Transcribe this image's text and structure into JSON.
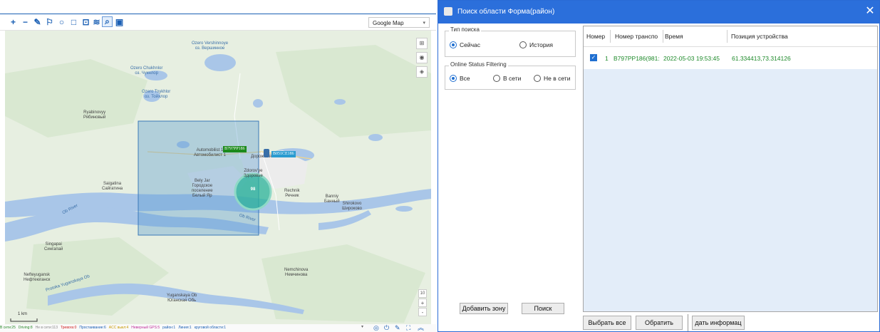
{
  "map": {
    "map_type": "Google Map",
    "labels": {
      "ozero_vershinnoye": "Ozero Vershinnoye\nоз. Вершинное",
      "ozero_chukhnlor": "Ozero Chukhnlor\nоз. Чукнлор",
      "ozero_toykhlor": "Ozero Toykhlor\nоз. Тойхлор",
      "ryabinovyy": "Ryabinovyy\nРябиновый",
      "automobilist": "Automobilist 1\nАвтомобилист 1",
      "zdorovye": "Zdorov'ye\nЗдоровье",
      "beliy_yar": "Bely Jar\nГородское\nпоселение\nБелый Яр",
      "saigatina": "Saigatina\nСайгатина",
      "ob_river_1": "Ob River",
      "ob_river_2": "Ob River",
      "rechnik": "Rechnik\nРечник",
      "banniy": "Banniy\nБанный",
      "shirokovo": "Shirokovo\nШироково",
      "singapai": "Singapai\nСингапай",
      "nefteyugansk": "Nefteyugansk\nНефтеюганск",
      "protoka": "Protoka Yuganskaya Ob",
      "nemchinova": "Nemchinova\nНемчинова",
      "yuganskaya_ob": "Yuganskaya Ob\nЮганская Обь",
      "dorozhniy": "Дорожный"
    },
    "vehicle_marker_1": "B797PP186",
    "vehicle_marker_2": "B051CE186",
    "cluster_count": "98",
    "scale": "1 km",
    "zoom_level": "10",
    "zoom_plus": "+",
    "zoom_minus": "-"
  },
  "statusbar": {
    "items": [
      {
        "text": "В сети:25",
        "color": "#2a8a2a"
      },
      {
        "text": "Driving:8",
        "color": "#2a8a2a"
      },
      {
        "text": "Не в сети:113",
        "color": "#888888"
      },
      {
        "text": "Тревога:0",
        "color": "#d02020"
      },
      {
        "text": "Простаивание:6",
        "color": "#1a5fb4"
      },
      {
        "text": "ACC выкл:4",
        "color": "#c69a00"
      },
      {
        "text": "Неверный GPS:5",
        "color": "#c0309a"
      },
      {
        "text": "район:1",
        "color": "#1a5fb4"
      },
      {
        "text": "Линия:1",
        "color": "#1a5fb4"
      },
      {
        "text": "круговой области:1",
        "color": "#1a5fb4"
      }
    ]
  },
  "dialog": {
    "title": "Поиск области Форма(район)",
    "close": "✕",
    "search_type": {
      "legend": "Тип поиска",
      "now": "Сейчас",
      "history": "История",
      "selected": "now"
    },
    "online_filter": {
      "legend": "Online Status Filtering",
      "all": "Все",
      "online": "В сети",
      "offline": "Не в сети",
      "selected": "all"
    },
    "add_zone_button": "Добавить зону",
    "search_button": "Поиск",
    "grid": {
      "columns": [
        "Номер",
        "Номер транспо",
        "Время",
        "Позиция устройства"
      ],
      "rows": [
        {
          "checked": true,
          "number": "1",
          "vehicle": "B797PP186(981:",
          "time": "2022-05-03 19:53:45",
          "position": "61.334413,73.314126"
        }
      ]
    },
    "select_all_button": "Выбрать все",
    "invert_button": "Обратить",
    "export_button": "дать информац"
  },
  "colors": {
    "accent": "#2b6fdb",
    "row_text": "#1e8a2a",
    "map_land": "#e7efe1",
    "map_water": "#a9c6e8",
    "search_rect": "#5a9bd0",
    "cluster": "#2bb39a"
  }
}
